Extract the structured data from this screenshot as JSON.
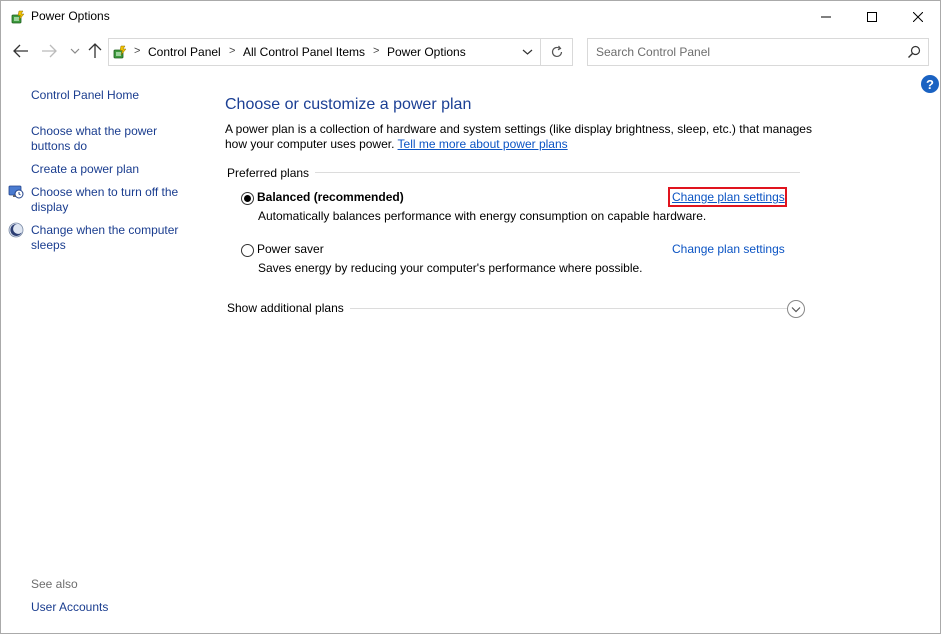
{
  "window": {
    "title": "Power Options",
    "minimize_glyph": "—",
    "maximize_glyph": "☐",
    "close_glyph": "✕"
  },
  "nav": {
    "breadcrumbs": [
      "Control Panel",
      "All Control Panel Items",
      "Power Options"
    ],
    "separator": ">",
    "search_placeholder": "Search Control Panel",
    "search_value": ""
  },
  "help": {
    "label": "?"
  },
  "sidebar": {
    "home": "Control Panel Home",
    "items": [
      {
        "label": "Choose what the power buttons do",
        "icon": ""
      },
      {
        "label": "Create a power plan",
        "icon": ""
      },
      {
        "label": "Choose when to turn off the display",
        "icon": "monitor-clock-icon"
      },
      {
        "label": "Change when the computer sleeps",
        "icon": "moon-icon"
      }
    ],
    "see_also_title": "See also",
    "see_also_items": [
      "User Accounts"
    ]
  },
  "main": {
    "heading": "Choose or customize a power plan",
    "description": "A power plan is a collection of hardware and system settings (like display brightness, sleep, etc.) that manages how your computer uses power.",
    "learn_more": "Tell me more about power plans",
    "preferred_label": "Preferred plans",
    "plans": [
      {
        "name": "Balanced (recommended)",
        "description": "Automatically balances performance with energy consumption on capable hardware.",
        "settings_link": "Change plan settings",
        "selected": true,
        "highlighted": true
      },
      {
        "name": "Power saver",
        "description": "Saves energy by reducing your computer's performance where possible.",
        "settings_link": "Change plan settings",
        "selected": false,
        "highlighted": false
      }
    ],
    "additional_label": "Show additional plans"
  },
  "colors": {
    "link": "#0b54c4",
    "heading": "#1b3f94",
    "highlight": "#e0141e",
    "help": "#1a62c2"
  }
}
